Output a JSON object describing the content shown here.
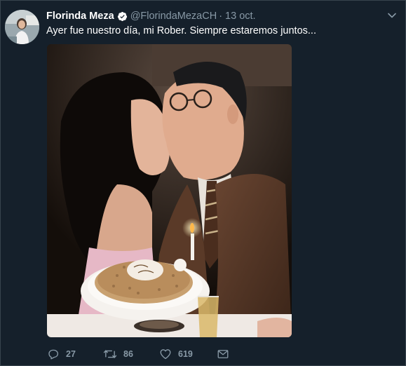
{
  "tweet": {
    "author": {
      "display_name": "Florinda Meza",
      "handle": "@FlorindaMezaCH",
      "verified": true
    },
    "separator": "·",
    "date": "13 oct.",
    "text": "Ayer fue nuestro día, mi Rober. Siempre estaremos juntos...",
    "actions": {
      "replies": "27",
      "retweets": "86",
      "likes": "619"
    }
  },
  "icons": {
    "verified": "verified-badge-icon",
    "caret": "chevron-down-icon",
    "reply": "reply-icon",
    "retweet": "retweet-icon",
    "like": "heart-icon",
    "message": "envelope-icon"
  },
  "colors": {
    "background": "#15202b",
    "secondary_text": "#8899a6",
    "verified": "#ffffff"
  }
}
